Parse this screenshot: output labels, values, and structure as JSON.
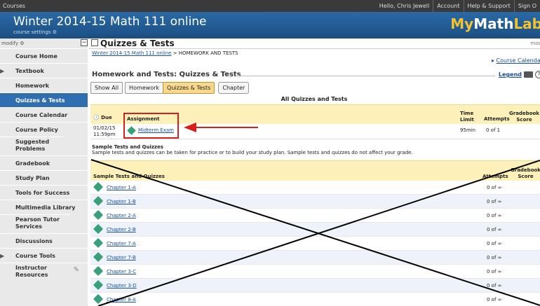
{
  "topbar": {
    "courses": "Courses",
    "greeting": "Hello, Chris Jewell",
    "account": "Account",
    "help": "Help & Support",
    "sign": "Sign O"
  },
  "header": {
    "title": "Winter 2014-15 Math 111 online",
    "settings": "course settings",
    "logo_my": "My",
    "logo_math": "Math",
    "logo_lab": "Lab"
  },
  "sidebar": {
    "modify": "modify",
    "items": [
      {
        "label": "Course Home"
      },
      {
        "label": "Textbook"
      },
      {
        "label": "Homework"
      },
      {
        "label": "Quizzes & Tests"
      },
      {
        "label": "Course Calendar"
      },
      {
        "label": "Course Policy"
      },
      {
        "label": "Suggested Problems"
      },
      {
        "label": "Gradebook"
      },
      {
        "label": "Study Plan"
      },
      {
        "label": "Tools for Success"
      },
      {
        "label": "Multimedia Library"
      },
      {
        "label": "Pearson Tutor Services"
      },
      {
        "label": "Discussions"
      },
      {
        "label": "Course Tools"
      },
      {
        "label": "Instructor Resources"
      }
    ]
  },
  "page": {
    "title": "Quizzes & Tests",
    "modify": "modi",
    "breadcrumb_link": "Winter 2014-15 Math 111 online",
    "breadcrumb_rest": " > HOMEWORK AND TESTS",
    "calendar_link": "Course Calendar",
    "section_title": "Homework and Tests: Quizzes & Tests",
    "legend": "Legend",
    "tabs": [
      "Show All",
      "Homework",
      "Quizzes & Tests",
      "Chapter"
    ],
    "all_title": "All Quizzes and Tests"
  },
  "graded": {
    "headers": {
      "due": "Due",
      "assignment": "Assignment",
      "time_limit_1": "Time",
      "time_limit_2": "Limit",
      "attempts": "Attempts",
      "gradebook_1": "Gradebook",
      "gradebook_2": "Score"
    },
    "rows": [
      {
        "due_date": "01/02/15",
        "due_time": "11:59pm",
        "name": "Midterm Exam",
        "time_limit": "95min",
        "attempts": "0 of 1"
      }
    ]
  },
  "sample": {
    "title": "Sample Tests and Quizzes",
    "desc": "Sample tests and quizzes can be taken for practice or to build your study plan. Sample tests and quizzes do not affect your grade.",
    "headers": {
      "name": "Sample Tests and Quizzes",
      "attempts": "Attempts",
      "gradebook_1": "Gradebook",
      "gradebook_2": "Score"
    },
    "rows": [
      {
        "name": "Chapter 1-A",
        "attempts": "0 of ∞"
      },
      {
        "name": "Chapter 1-B",
        "attempts": "0 of ∞"
      },
      {
        "name": "Chapter 2-A",
        "attempts": "0 of ∞"
      },
      {
        "name": "Chapter 2-B",
        "attempts": "0 of ∞"
      },
      {
        "name": "Chapter 7-A",
        "attempts": "0 of ∞"
      },
      {
        "name": "Chapter 7-B",
        "attempts": "0 of ∞"
      },
      {
        "name": "Chapter 3-C",
        "attempts": "0 of ∞"
      },
      {
        "name": "Chapter 3-D",
        "attempts": "0 of ∞"
      },
      {
        "name": "Chapter 8-A",
        "attempts": "0 of ∞"
      }
    ]
  },
  "colors": {
    "header_blue": "#1b4f82",
    "active_nav": "#2f6fb0",
    "table_header": "#fdf0b8",
    "highlight_red": "#d62020",
    "assignment_icon": "#3aa07a"
  }
}
